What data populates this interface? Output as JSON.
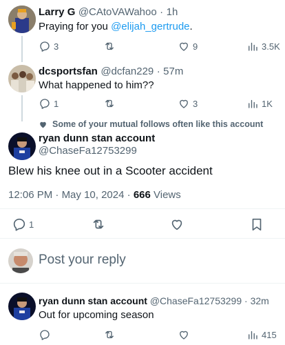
{
  "replies": [
    {
      "name": "Larry G",
      "handle": "@CAtoVAWahoo",
      "time": "1h",
      "text_prefix": "Praying for you ",
      "mention": "@elijah_gertrude",
      "text_suffix": ".",
      "stats": {
        "replies": "3",
        "retweets": "",
        "likes": "9",
        "views": "3.5K"
      }
    },
    {
      "name": "dcsportsfan",
      "handle": "@dcfan229",
      "time": "57m",
      "text": "What happened to him??",
      "stats": {
        "replies": "1",
        "retweets": "",
        "likes": "3",
        "views": "1K"
      }
    }
  ],
  "social_context": "Some of your mutual follows often like this account",
  "main_tweet": {
    "name": "ryan dunn stan account",
    "handle": "@ChaseFa12753299",
    "text": "Blew his knee out in a Scooter accident",
    "time": "12:06 PM",
    "date": "May 10, 2024",
    "views_count": "666",
    "views_label": "Views",
    "reply_count": "1"
  },
  "reply_box": {
    "placeholder": "Post your reply"
  },
  "thread_reply": {
    "name": "ryan dunn stan account",
    "handle": "@ChaseFa12753299",
    "time": "32m",
    "text": "Out for upcoming season",
    "stats": {
      "views": "415"
    }
  },
  "colors": {
    "accent": "#1d9bf0",
    "secondary_text": "#536471",
    "divider": "#eff3f4"
  }
}
